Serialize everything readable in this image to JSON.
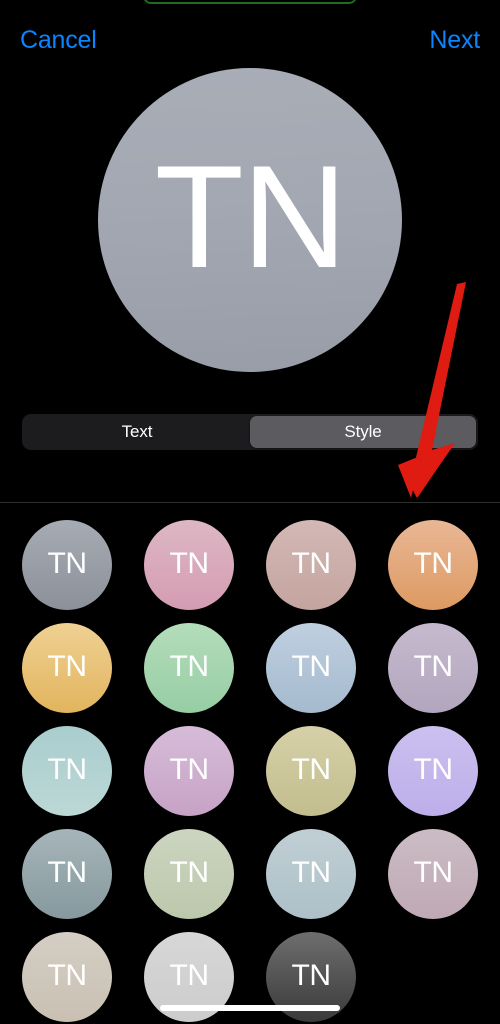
{
  "statusbar": {
    "recording_indicator": "screen-recording-frame"
  },
  "navbar": {
    "cancel_label": "Cancel",
    "next_label": "Next",
    "tint_color": "#0a84ff"
  },
  "preview": {
    "initials": "TN",
    "bg_top": "#a9adb6",
    "bg_bottom": "#989da7"
  },
  "segmented_control": {
    "selected": "Style",
    "segments": [
      {
        "label": "Text",
        "selected": false
      },
      {
        "label": "Style",
        "selected": true
      }
    ],
    "track_color": "#1c1c1e",
    "selected_color": "#5b5b60"
  },
  "style_grid": {
    "initials": "TN",
    "columns": 4,
    "swatches": [
      {
        "name": "gray-blue",
        "top": "#a6abb4",
        "bottom": "#8b9099",
        "initials": "TN"
      },
      {
        "name": "dusty-pink",
        "top": "#ddb7c4",
        "bottom": "#d49cb2",
        "initials": "TN"
      },
      {
        "name": "rosy-taupe",
        "top": "#d3b8b5",
        "bottom": "#c4a49f",
        "initials": "TN"
      },
      {
        "name": "peach-orange",
        "top": "#e9b795",
        "bottom": "#dd9a62",
        "initials": "TN"
      },
      {
        "name": "golden-yellow",
        "top": "#efd193",
        "bottom": "#e2b45e",
        "initials": "TN"
      },
      {
        "name": "mint-green",
        "top": "#b4ddba",
        "bottom": "#96cda4",
        "initials": "TN"
      },
      {
        "name": "powder-blue",
        "top": "#bfcfe0",
        "bottom": "#a5bace",
        "initials": "TN"
      },
      {
        "name": "lavender-mauve",
        "top": "#c5bacd",
        "bottom": "#b2a6be",
        "initials": "TN"
      },
      {
        "name": "pale-teal",
        "top": "#a9cdce",
        "bottom": "#bcd8d6",
        "initials": "TN"
      },
      {
        "name": "orchid-lilac",
        "top": "#d6bcd8",
        "bottom": "#c7a2c6",
        "initials": "TN"
      },
      {
        "name": "khaki-olive",
        "top": "#d6d0a8",
        "bottom": "#c2bd8e",
        "initials": "TN"
      },
      {
        "name": "periwinkle",
        "top": "#cbc0ef",
        "bottom": "#bdaeea",
        "initials": "TN"
      },
      {
        "name": "slate-blue-gray",
        "top": "#a6b5b9",
        "bottom": "#86999e",
        "initials": "TN"
      },
      {
        "name": "sage-green",
        "top": "#ccd5c0",
        "bottom": "#bcc8ac",
        "initials": "TN"
      },
      {
        "name": "pale-blue-gray",
        "top": "#c0cfd4",
        "bottom": "#adc0c8",
        "initials": "TN"
      },
      {
        "name": "dusty-mauve",
        "top": "#cbbcc4",
        "bottom": "#bfa9b4",
        "initials": "TN"
      },
      {
        "name": "warm-beige",
        "top": "#d4cec4",
        "bottom": "#c9c0b2",
        "initials": "TN"
      },
      {
        "name": "light-gray",
        "top": "#d7d7d7",
        "bottom": "#cccccc",
        "initials": "TN"
      },
      {
        "name": "charcoal-dark",
        "top": "#6e6e6e",
        "bottom": "#3a3a3a",
        "initials": "TN"
      }
    ]
  },
  "annotation": {
    "type": "arrow",
    "color": "#e01b12",
    "points_at": "Style"
  },
  "home_indicator": {
    "label": "home-indicator"
  }
}
